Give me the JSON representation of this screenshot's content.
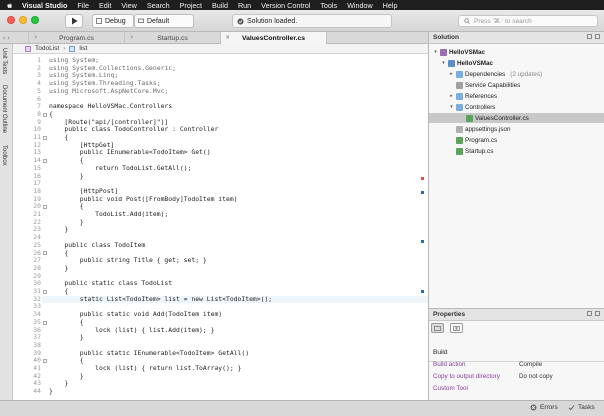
{
  "menubar": {
    "app_name": "Visual Studio",
    "items": [
      "File",
      "Edit",
      "View",
      "Search",
      "Project",
      "Build",
      "Run",
      "Version Control",
      "Tools",
      "Window",
      "Help"
    ]
  },
  "toolbar": {
    "config": "Debug",
    "target": "Default",
    "status": "Solution loaded.",
    "search_placeholder": "Press '⌘.' to search"
  },
  "tabs": [
    {
      "label": "Program.cs",
      "active": false
    },
    {
      "label": "Startup.cs",
      "active": false
    },
    {
      "label": "ValuesController.cs",
      "active": true
    }
  ],
  "left_pads": [
    "Unit Tests",
    "Document Outline",
    "Toolbox"
  ],
  "breadcrumb": {
    "class": "TodoList",
    "member": "list"
  },
  "code_lines": [
    "using System;",
    "using System.Collections.Generic;",
    "using System.Linq;",
    "using System.Threading.Tasks;",
    "using Microsoft.AspNetCore.Mvc;",
    "",
    "namespace HelloVSMac.Controllers",
    "{",
    "    [Route(\"api/[controller]\")]",
    "    public class TodoController : Controller",
    "    {",
    "        [HttpGet]",
    "        public IEnumerable<TodoItem> Get()",
    "        {",
    "            return TodoList.GetAll();",
    "        }",
    "",
    "        [HttpPost]",
    "        public void Post([FromBody]TodoItem item)",
    "        {",
    "            TodoList.Add(item);",
    "        }",
    "    }",
    "",
    "    public class TodoItem",
    "    {",
    "        public string Title { get; set; }",
    "    }",
    "",
    "    public static class TodoList",
    "    {",
    "        static List<TodoItem> list = new List<TodoItem>();",
    "",
    "        public static void Add(TodoItem item)",
    "        {",
    "            lock (list) { list.Add(item); }",
    "        }",
    "",
    "        public static IEnumerable<TodoItem> GetAll()",
    "        {",
    "            lock (list) { return list.ToArray(); }",
    "        }",
    "    }",
    "}"
  ],
  "solution": {
    "title": "Solution",
    "nodes": [
      {
        "label": "HelloVSMac",
        "bold": true,
        "icon": "solution-icon"
      },
      {
        "label": "HelloVSMac",
        "bold": true,
        "icon": "project-icon"
      },
      {
        "label": "Dependencies",
        "extra": "(2 updates)",
        "icon": "folder-icon"
      },
      {
        "label": "Service Capabilities",
        "icon": "capabilities-icon"
      },
      {
        "label": "References",
        "icon": "folder-icon"
      },
      {
        "label": "Controllers",
        "icon": "folder-icon"
      },
      {
        "label": "ValuesController.cs",
        "icon": "cs-file-icon",
        "selected": true
      },
      {
        "label": "appsettings.json",
        "icon": "json-file-icon"
      },
      {
        "label": "Program.cs",
        "icon": "cs-file-icon"
      },
      {
        "label": "Startup.cs",
        "icon": "cs-file-icon"
      }
    ]
  },
  "properties": {
    "title": "Properties",
    "section": "Build",
    "rows": [
      {
        "key": "Build action",
        "value": "Compile"
      },
      {
        "key": "Copy to output directory",
        "value": "Do not copy"
      },
      {
        "key": "Custom Tool",
        "value": ""
      }
    ]
  },
  "statusbar": {
    "errors": "Errors",
    "tasks": "Tasks"
  },
  "colors": {
    "selection": "#c8c8c8",
    "current_line": "#eef5fb",
    "keyword": "#8a3d9e",
    "type": "#2c6aa6",
    "string": "#c0392b"
  }
}
